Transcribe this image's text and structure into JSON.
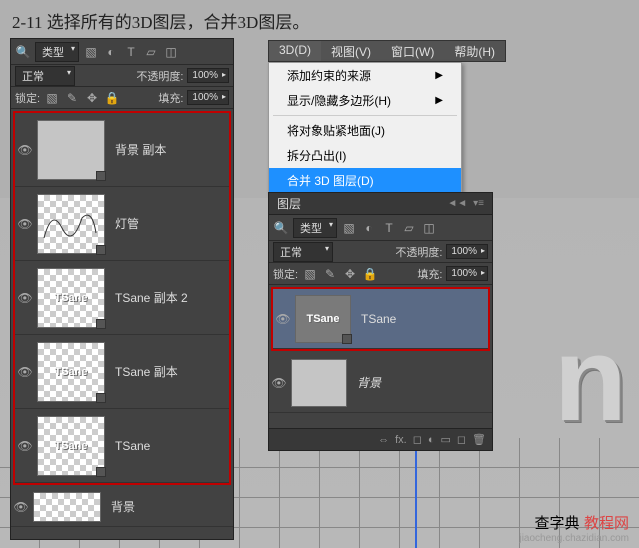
{
  "title": "2-11 选择所有的3D图层，合并3D图层。",
  "menubar": {
    "items": [
      {
        "label": "3D(D)",
        "active": true
      },
      {
        "label": "视图(V)",
        "active": false
      },
      {
        "label": "窗口(W)",
        "active": false
      },
      {
        "label": "帮助(H)",
        "active": false
      }
    ]
  },
  "dropdown": {
    "items": [
      {
        "label": "添加约束的来源",
        "arrow": true
      },
      {
        "label": "显示/隐藏多边形(H)",
        "arrow": true
      },
      {
        "sep": true
      },
      {
        "label": "将对象贴紧地面(J)",
        "arrow": false
      },
      {
        "label": "拆分凸出(I)",
        "arrow": false
      },
      {
        "label": "合并 3D 图层(D)",
        "arrow": false,
        "highlight": true
      }
    ]
  },
  "panel_left": {
    "filter_label": "类型",
    "blend_mode": "正常",
    "opacity_label": "不透明度:",
    "opacity_value": "100%",
    "lock_label": "锁定:",
    "fill_label": "填充:",
    "fill_value": "100%",
    "layers": [
      {
        "name": "背景 副本",
        "thumb": "solid"
      },
      {
        "name": "灯管",
        "thumb": "checker-line"
      },
      {
        "name": "TSane 副本 2",
        "thumb": "checker-text"
      },
      {
        "name": "TSane 副本",
        "thumb": "checker-text"
      },
      {
        "name": "TSane",
        "thumb": "checker-text"
      },
      {
        "name": "背景",
        "thumb": "checker"
      }
    ]
  },
  "panel_right": {
    "tab_label": "图层",
    "filter_label": "类型",
    "blend_mode": "正常",
    "opacity_label": "不透明度:",
    "opacity_value": "100%",
    "lock_label": "锁定:",
    "fill_label": "填充:",
    "fill_value": "100%",
    "layers": [
      {
        "name": "TSane",
        "thumb_text": "TSane",
        "selected": true
      },
      {
        "name": "背景",
        "thumb": "solid"
      }
    ]
  },
  "text3d": "n",
  "watermark": {
    "line1": "查字典",
    "line2": "教程网",
    "url": "jiaocheng.chazidian.com"
  }
}
